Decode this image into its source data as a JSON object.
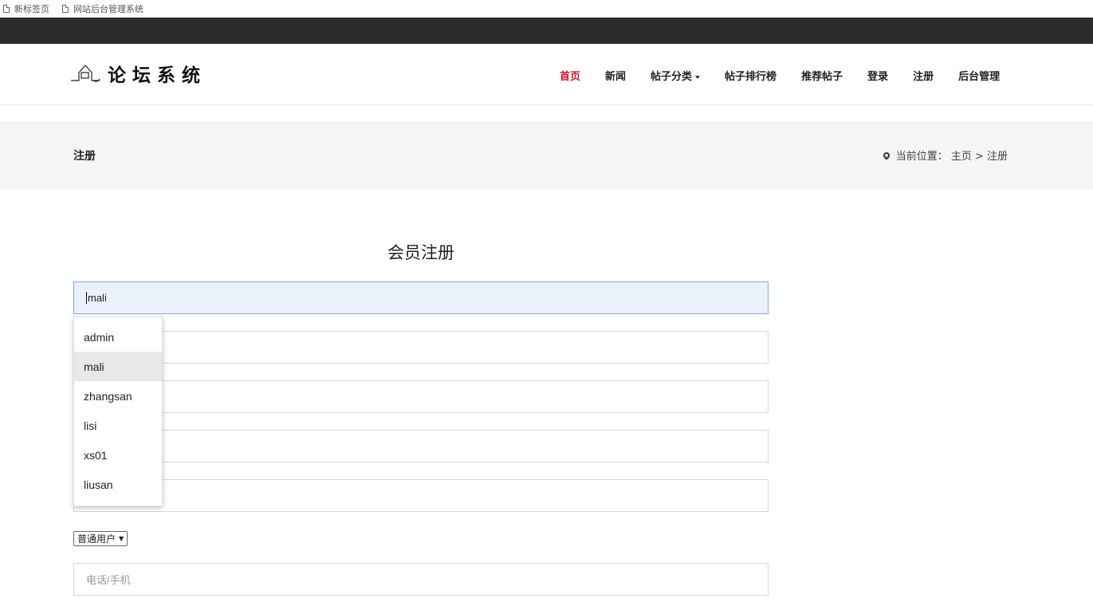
{
  "browser": {
    "bookmarks": [
      {
        "label": "新标签页"
      },
      {
        "label": "网站后台管理系统"
      }
    ]
  },
  "header": {
    "logo_text": "论坛系统",
    "nav": [
      {
        "label": "首页",
        "active": true
      },
      {
        "label": "新闻"
      },
      {
        "label": "帖子分类"
      },
      {
        "label": "帖子排行榜"
      },
      {
        "label": "推荐帖子"
      },
      {
        "label": "登录"
      },
      {
        "label": "注册"
      },
      {
        "label": "后台管理"
      }
    ],
    "active_color": "#c8152d"
  },
  "titlebar": {
    "title": "注册",
    "breadcrumb": "当前位置：  主页 > 注册"
  },
  "form": {
    "title": "会员注册",
    "username_value": "mali",
    "role_select": "普通用户",
    "phone_placeholder": "电话/手机"
  },
  "autocomplete": {
    "items": [
      "admin",
      "mali",
      "zhangsan",
      "lisi",
      "xs01",
      "liusan"
    ],
    "hovered_index": 1
  }
}
